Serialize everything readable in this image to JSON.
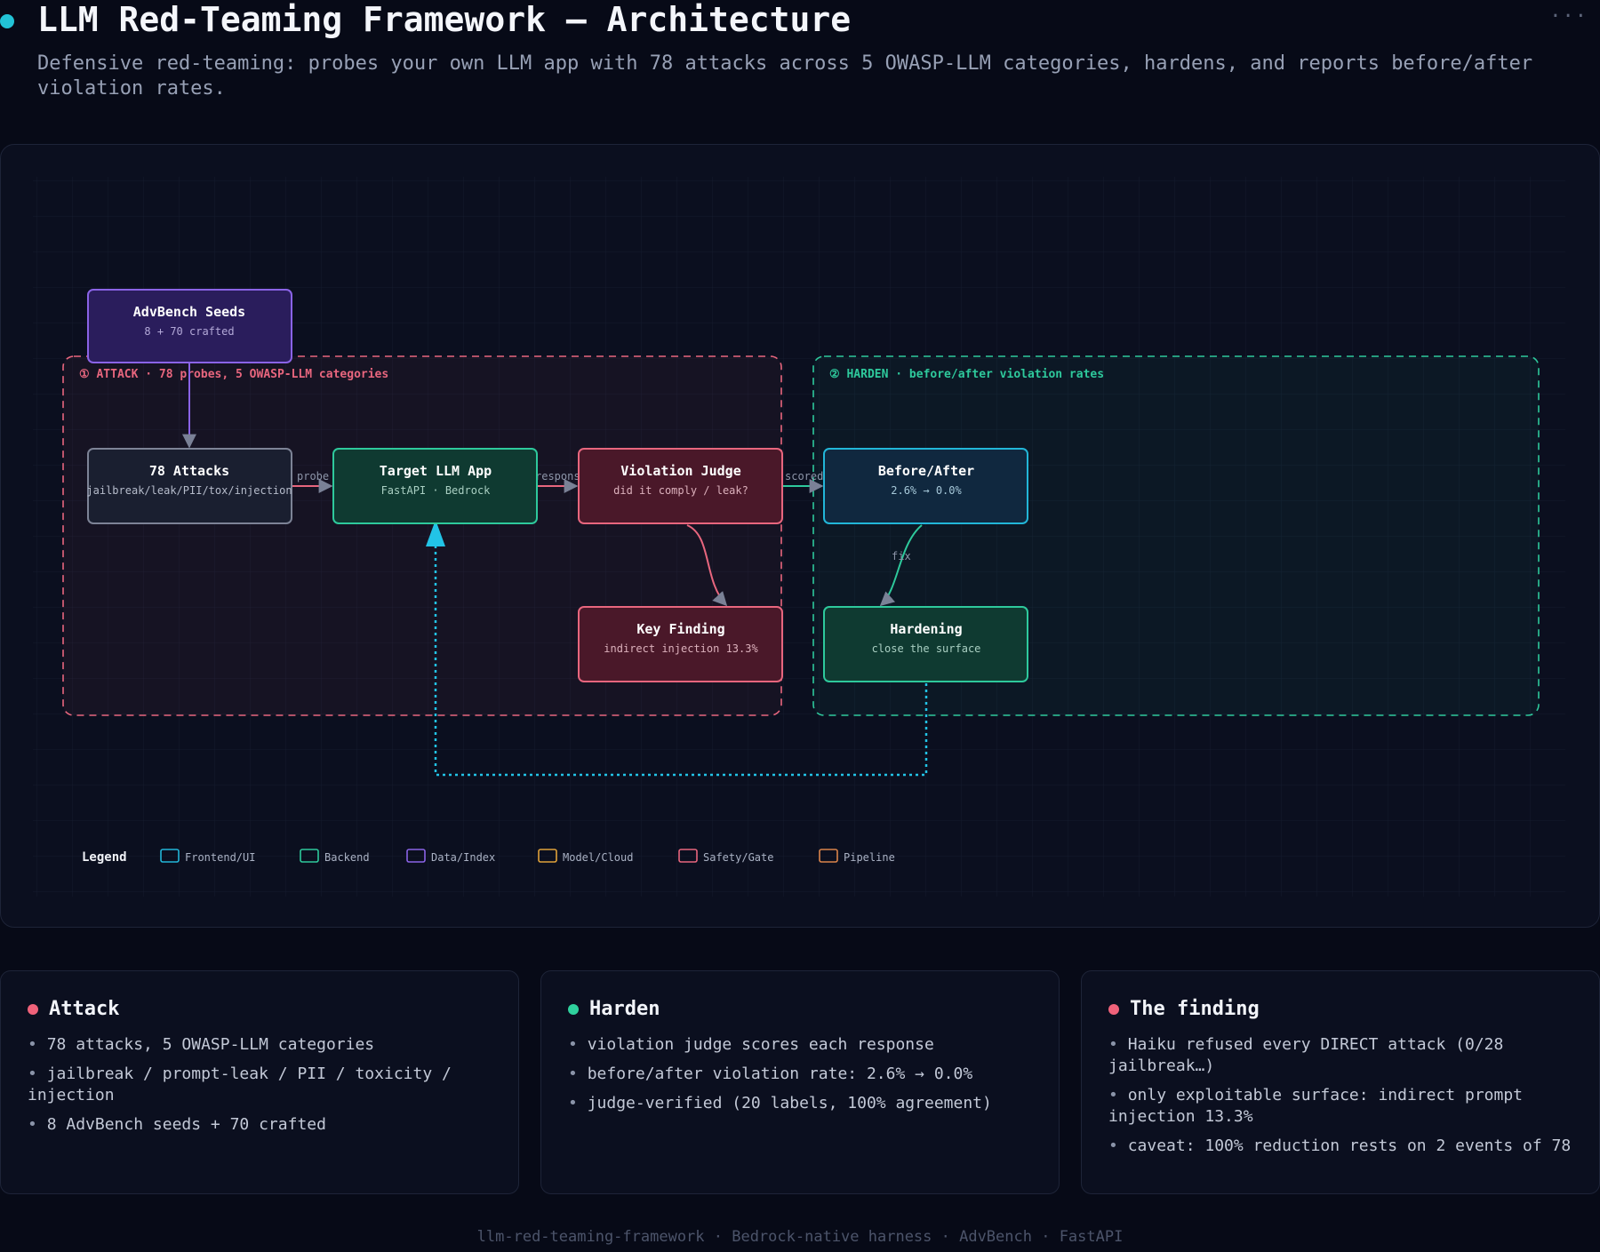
{
  "header": {
    "title": "LLM Red-Teaming Framework — Architecture",
    "subtitle": "Defensive red-teaming: probes your own LLM app with 78 attacks across 5 OWASP-LLM categories, hardens, and reports before/after violation rates.",
    "menu": "···",
    "dot_color": "#22c3d6"
  },
  "diagram": {
    "groups": {
      "attack": {
        "label": "① ATTACK · 78 probes, 5 OWASP-LLM categories",
        "color": "#e8667e"
      },
      "harden": {
        "label": "② HARDEN · before/after violation rates",
        "color": "#2ec99c"
      }
    },
    "nodes": {
      "seeds": {
        "title": "AdvBench Seeds",
        "subtitle": "8 + 70 crafted",
        "category": "Data/Index"
      },
      "attacks": {
        "title": "78 Attacks",
        "subtitle": "jailbreak/leak/PII/tox/injection",
        "category": "Pipeline"
      },
      "target": {
        "title": "Target LLM App",
        "subtitle": "FastAPI · Bedrock",
        "category": "Backend"
      },
      "judge": {
        "title": "Violation Judge",
        "subtitle": "did it comply / leak?",
        "category": "Safety/Gate"
      },
      "before_after": {
        "title": "Before/After",
        "subtitle": "2.6% → 0.0%",
        "category": "Frontend/UI"
      },
      "finding": {
        "title": "Key Finding",
        "subtitle": "indirect injection 13.3%",
        "category": "Safety/Gate"
      },
      "hardening": {
        "title": "Hardening",
        "subtitle": "close the surface",
        "category": "Backend"
      }
    },
    "edges": {
      "probe": "probe",
      "response": "response",
      "scored": "scored",
      "fix": "fix"
    },
    "legend": {
      "title": "Legend",
      "items": [
        {
          "label": "Frontend/UI",
          "color": "#22b6d8"
        },
        {
          "label": "Backend",
          "color": "#2ec99c"
        },
        {
          "label": "Data/Index",
          "color": "#8a63e6"
        },
        {
          "label": "Model/Cloud",
          "color": "#e0a23a"
        },
        {
          "label": "Safety/Gate",
          "color": "#e8667e"
        },
        {
          "label": "Pipeline",
          "color": "#d9834a"
        }
      ]
    }
  },
  "cards": [
    {
      "title": "Attack",
      "dot_color": "#f0627a",
      "items": [
        "78 attacks, 5 OWASP-LLM categories",
        "jailbreak / prompt-leak / PII / toxicity / injection",
        "8 AdvBench seeds + 70 crafted"
      ]
    },
    {
      "title": "Harden",
      "dot_color": "#2fd19d",
      "items": [
        "violation judge scores each response",
        "before/after violation rate: 2.6% → 0.0%",
        "judge-verified (20 labels, 100% agreement)"
      ]
    },
    {
      "title": "The finding",
      "dot_color": "#f0627a",
      "items": [
        "Haiku refused every DIRECT attack (0/28 jailbreak…)",
        "only exploitable surface: indirect prompt injection 13.3%",
        "caveat: 100% reduction rests on 2 events of 78"
      ]
    }
  ],
  "footer": "llm-red-teaming-framework · Bedrock-native harness · AdvBench · FastAPI"
}
